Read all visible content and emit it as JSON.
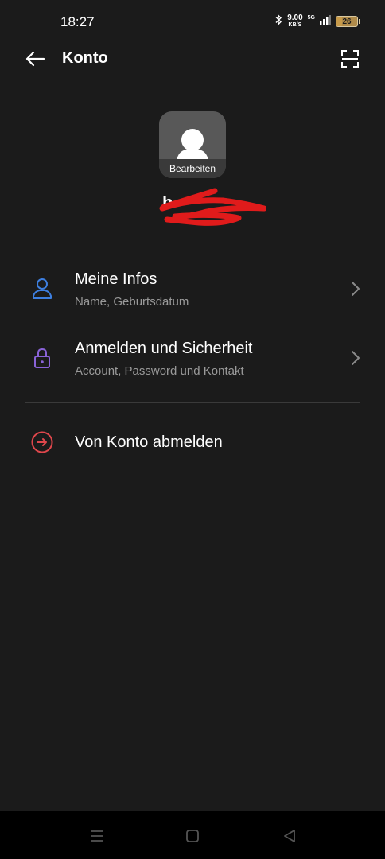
{
  "status_bar": {
    "time": "18:27",
    "net_speed_value": "9.00",
    "net_speed_unit": "KB/S",
    "network_type": "5G",
    "battery_level": "26",
    "battery_fraction": 0.26
  },
  "header": {
    "title": "Konto"
  },
  "profile": {
    "edit_label": "Bearbeiten",
    "username_visible": "b"
  },
  "menu": {
    "items": [
      {
        "title": "Meine Infos",
        "subtitle": "Name, Geburtsdatum",
        "icon": "person-icon",
        "color": "#3d7fe0"
      },
      {
        "title": "Anmelden und Sicherheit",
        "subtitle": "Account, Password und Kontakt",
        "icon": "lock-icon",
        "color": "#8a63d8"
      }
    ],
    "logout": {
      "title": "Von Konto abmelden",
      "icon": "logout-icon",
      "color": "#e0474c"
    }
  },
  "colors": {
    "background": "#1b1b1b",
    "scribble": "#e01b1b"
  }
}
